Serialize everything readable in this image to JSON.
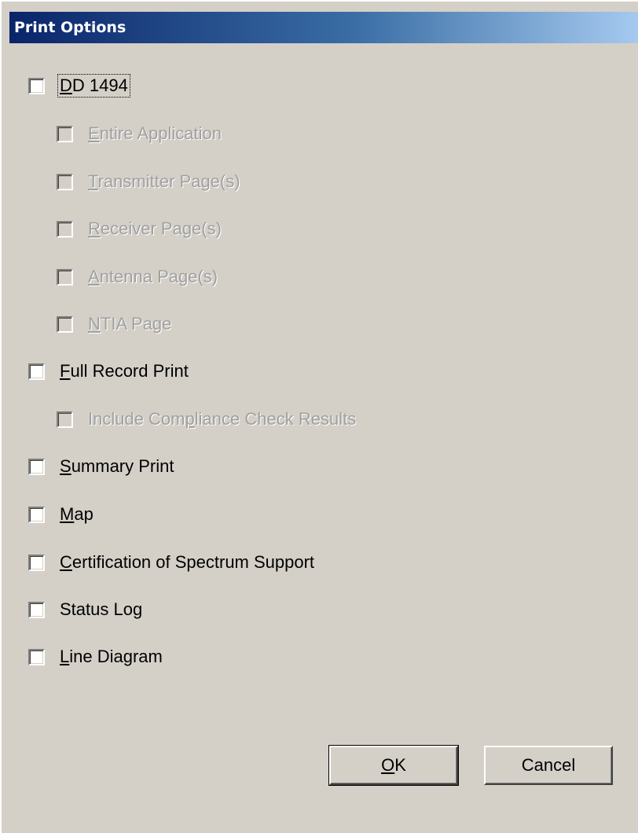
{
  "window": {
    "title": "Print Options"
  },
  "options": [
    {
      "id": "dd1494",
      "pre": "",
      "key": "D",
      "post": "D 1494",
      "checked": false,
      "enabled": true,
      "focused": true,
      "indent": 0
    },
    {
      "id": "entire-application",
      "pre": "",
      "key": "E",
      "post": "ntire Application",
      "checked": false,
      "enabled": false,
      "focused": false,
      "indent": 1
    },
    {
      "id": "transmitter-pages",
      "pre": "",
      "key": "T",
      "post": "ransmitter Page(s)",
      "checked": false,
      "enabled": false,
      "focused": false,
      "indent": 1
    },
    {
      "id": "receiver-pages",
      "pre": "",
      "key": "R",
      "post": "eceiver Page(s)",
      "checked": false,
      "enabled": false,
      "focused": false,
      "indent": 1
    },
    {
      "id": "antenna-pages",
      "pre": "",
      "key": "A",
      "post": "ntenna Page(s)",
      "checked": false,
      "enabled": false,
      "focused": false,
      "indent": 1
    },
    {
      "id": "ntia-page",
      "pre": "",
      "key": "N",
      "post": "TIA Page",
      "checked": false,
      "enabled": false,
      "focused": false,
      "indent": 1
    },
    {
      "id": "full-record-print",
      "pre": "",
      "key": "F",
      "post": "ull Record Print",
      "checked": false,
      "enabled": true,
      "focused": false,
      "indent": 0
    },
    {
      "id": "include-compliance",
      "pre": "Include Com",
      "key": "p",
      "post": "liance Check Results",
      "checked": false,
      "enabled": false,
      "focused": false,
      "indent": 1
    },
    {
      "id": "summary-print",
      "pre": "",
      "key": "S",
      "post": "ummary Print",
      "checked": false,
      "enabled": true,
      "focused": false,
      "indent": 0
    },
    {
      "id": "map",
      "pre": "",
      "key": "M",
      "post": "ap",
      "checked": false,
      "enabled": true,
      "focused": false,
      "indent": 0
    },
    {
      "id": "certification-spectrum-support",
      "pre": "",
      "key": "C",
      "post": "ertification of Spectrum Support",
      "checked": false,
      "enabled": true,
      "focused": false,
      "indent": 0
    },
    {
      "id": "status-log",
      "pre": "Status Lo",
      "key": "g",
      "post": "",
      "checked": false,
      "enabled": true,
      "focused": false,
      "indent": 0
    },
    {
      "id": "line-diagram",
      "pre": "",
      "key": "L",
      "post": "ine Diagram",
      "checked": false,
      "enabled": true,
      "focused": false,
      "indent": 0
    }
  ],
  "buttons": {
    "ok": {
      "pre": "",
      "key": "O",
      "post": "K"
    },
    "cancel": {
      "label": "Cancel"
    }
  }
}
